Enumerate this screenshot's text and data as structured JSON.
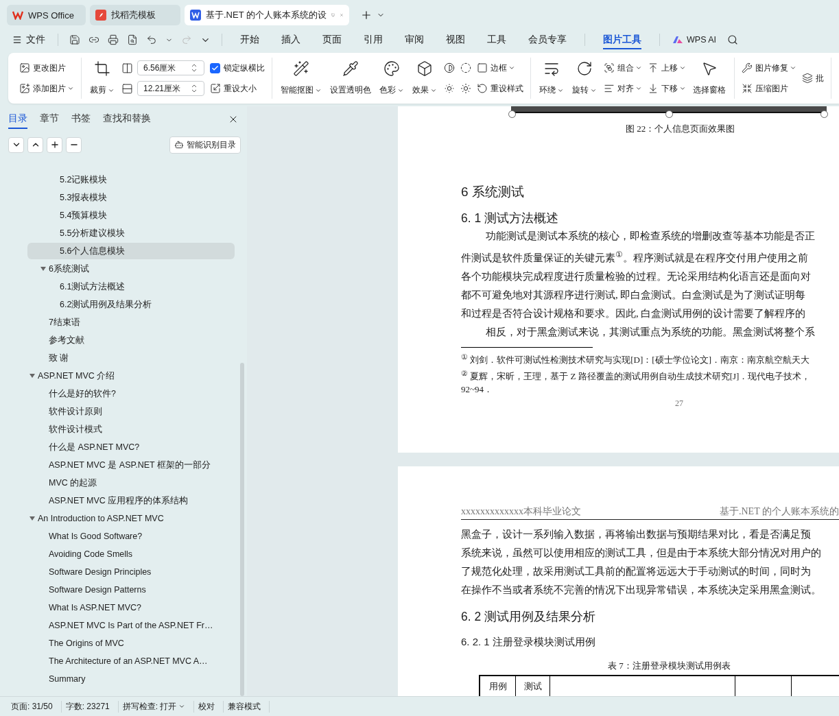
{
  "window_tabs": [
    {
      "kind": "home",
      "label": "WPS Office",
      "selected": false
    },
    {
      "kind": "template",
      "label": "找稻壳模板",
      "selected": false
    },
    {
      "kind": "document",
      "label": "基于.NET 的个人账本系统的设",
      "selected": true
    }
  ],
  "menu": {
    "file": "文件",
    "ai": "WPS AI",
    "tabs": [
      {
        "label": "开始",
        "selected": false,
        "contextual": false
      },
      {
        "label": "插入",
        "selected": false,
        "contextual": false
      },
      {
        "label": "页面",
        "selected": false,
        "contextual": false
      },
      {
        "label": "引用",
        "selected": false,
        "contextual": false
      },
      {
        "label": "审阅",
        "selected": false,
        "contextual": false
      },
      {
        "label": "视图",
        "selected": false,
        "contextual": false
      },
      {
        "label": "工具",
        "selected": false,
        "contextual": false
      },
      {
        "label": "会员专享",
        "selected": false,
        "contextual": false
      },
      {
        "label": "图片工具",
        "selected": true,
        "contextual": true
      }
    ]
  },
  "ribbon": {
    "groups": [
      [
        [
          {
            "kind": "small",
            "label": "更改图片",
            "dropdown": false
          },
          {
            "kind": "small",
            "label": "添加图片",
            "dropdown": true
          }
        ]
      ],
      [
        [
          {
            "kind": "big",
            "label": "裁剪",
            "dropdown": true
          }
        ],
        [
          {
            "kind": "field",
            "value": "6.56厘米"
          },
          {
            "kind": "field",
            "value": "12.21厘米"
          }
        ],
        [
          {
            "kind": "checkbox",
            "label": "锁定纵横比",
            "checked": true
          },
          {
            "kind": "small",
            "label": "重设大小",
            "dropdown": false
          }
        ]
      ],
      [
        [
          {
            "kind": "big",
            "label": "智能抠图",
            "dropdown": true
          }
        ],
        [
          {
            "kind": "big",
            "label": "设置透明色",
            "dropdown": false
          }
        ],
        [
          {
            "kind": "big",
            "label": "色彩",
            "dropdown": true
          }
        ],
        [
          {
            "kind": "big",
            "label": "效果",
            "dropdown": true
          }
        ],
        [
          {
            "kind": "icon"
          },
          {
            "kind": "icon"
          }
        ],
        [
          {
            "kind": "icon"
          },
          {
            "kind": "icon"
          }
        ],
        [
          {
            "kind": "small",
            "label": "边框",
            "dropdown": true
          },
          {
            "kind": "small",
            "label": "重设样式",
            "dropdown": false
          }
        ]
      ],
      [
        [
          {
            "kind": "big",
            "label": "环绕",
            "dropdown": true
          }
        ],
        [
          {
            "kind": "big",
            "label": "旋转",
            "dropdown": true
          }
        ],
        [
          {
            "kind": "small",
            "label": "组合",
            "dropdown": true
          },
          {
            "kind": "small",
            "label": "对齐",
            "dropdown": true
          }
        ],
        [
          {
            "kind": "small",
            "label": "上移",
            "dropdown": true
          },
          {
            "kind": "small",
            "label": "下移",
            "dropdown": true
          }
        ],
        [
          {
            "kind": "big",
            "label": "选择窗格",
            "dropdown": false
          }
        ]
      ],
      [
        [
          {
            "kind": "small",
            "label": "图片修复",
            "dropdown": true
          },
          {
            "kind": "small",
            "label": "压缩图片",
            "dropdown": false
          }
        ],
        [
          {
            "kind": "small",
            "label": "批",
            "dropdown": false
          }
        ]
      ]
    ]
  },
  "nav_pane": {
    "tabs": [
      {
        "label": "目录",
        "selected": true
      },
      {
        "label": "章节",
        "selected": false
      },
      {
        "label": "书签",
        "selected": false
      },
      {
        "label": "查找和替换",
        "selected": false
      }
    ],
    "smart_button": "智能识别目录",
    "toc": [
      {
        "children": [
          {
            "children": [
              {
                "label": "5.2记账模块",
                "selected": false
              },
              {
                "label": "5.3报表模块",
                "selected": false
              },
              {
                "label": "5.4预算模块",
                "selected": false
              },
              {
                "label": "5.5分析建议模块",
                "selected": false
              },
              {
                "label": "5.6个人信息模块",
                "selected": true
              }
            ]
          },
          {
            "label": "6系统测试",
            "selected": false,
            "expanded": true,
            "children": [
              {
                "label": "6.1测试方法概述",
                "selected": false
              },
              {
                "label": "6.2测试用例及结果分析",
                "selected": false
              }
            ]
          },
          {
            "label": "7结束语",
            "selected": false
          },
          {
            "label": "参考文献",
            "selected": false
          },
          {
            "label": "致 谢",
            "selected": false
          }
        ]
      },
      {
        "label": "ASP.NET MVC 介绍",
        "selected": false,
        "expanded": true,
        "children": [
          {
            "label": "什么是好的软件?",
            "selected": false
          },
          {
            "label": "软件设计原则",
            "selected": false
          },
          {
            "label": "软件设计模式",
            "selected": false
          },
          {
            "label": "什么是 ASP.NET MVC?",
            "selected": false
          },
          {
            "label": "ASP.NET MVC 是 ASP.NET 框架的一部分",
            "selected": false
          },
          {
            "label": "MVC 的起源",
            "selected": false
          },
          {
            "label": "ASP.NET MVC 应用程序的体系结构",
            "selected": false
          }
        ]
      },
      {
        "label": "An Introduction to ASP.NET MVC",
        "selected": false,
        "expanded": true,
        "children": [
          {
            "label": "What Is Good Software?",
            "selected": false
          },
          {
            "label": "Avoiding Code Smells",
            "selected": false
          },
          {
            "label": "Software Design Principles",
            "selected": false
          },
          {
            "label": "Software Design Patterns",
            "selected": false
          },
          {
            "label": "What Is ASP.NET MVC?",
            "selected": false
          },
          {
            "label": "ASP.NET MVC Is Part of the ASP.NET Fr…",
            "selected": false
          },
          {
            "label": "The Origins of MVC",
            "selected": false
          },
          {
            "label": "The Architecture of an ASP.NET MVC A…",
            "selected": false
          },
          {
            "label": "Summary",
            "selected": false
          }
        ]
      }
    ]
  },
  "document": {
    "pages": [
      {
        "image": {
          "selected": true
        },
        "blocks": [
          {
            "kind": "caption",
            "text": "图 22：个人信息页面效果图"
          },
          {
            "kind": "h1",
            "text": "6 系统测试"
          },
          {
            "kind": "h2",
            "text": "6. 1 测试方法概述"
          },
          {
            "kind": "first_line",
            "text": "功能测试是测试本系统的核心，即检查系统的增删改查等基本功能是否正"
          },
          {
            "kind": "line",
            "text": "件测试是软件质量保证的关键元素$^{①}$。程序测试就是在程序交付用户使用之前"
          },
          {
            "kind": "line",
            "text": "各个功能模块完成程度进行质量检验的过程。无论采用结构化语言还是面向对"
          },
          {
            "kind": "line",
            "text": "都不可避免地对其源程序进行测试, 即白盒测试。白盒测试是为了测试证明每"
          },
          {
            "kind": "line",
            "text": "和过程是否符合设计规格和要求。因此, 白盒测试用例的设计需要了解程序的"
          },
          {
            "kind": "first_line",
            "text": "相反，对于黑盒测试来说，其测试重点为系统的功能。黑盒测试将整个系"
          }
        ],
        "footnotes": [
          "$^{①}$ 刘剑．软件可测试性检测技术研究与实现[D]：[硕士学位论文]．南京：南京航空航天大",
          "$^{②}$ 夏辉，宋昕，王理，基于 Z 路径覆盖的测试用例自动生成技术研究[J]．现代电子技术，",
          "92~94．"
        ],
        "page_number": "27"
      },
      {
        "header_left": "xxxxxxxxxxxxx本科毕业论文",
        "header_right": "基于.NET 的个人账本系统的",
        "blocks": [
          {
            "kind": "line",
            "text": "黑盒子，设计一系列输入数据，再将输出数据与预期结果对比，看是否满足预"
          },
          {
            "kind": "line",
            "text": "系统来说，虽然可以使用相应的测试工具，但是由于本系统大部分情况对用户的"
          },
          {
            "kind": "line",
            "text": "了规范化处理，故采用测试工具前的配置将远远大于手动测试的时间，同时为"
          },
          {
            "kind": "line",
            "text": "在操作不当或者系统不完善的情况下出现异常错误，本系统决定采用黑盒测试。"
          },
          {
            "kind": "h2",
            "text": "6. 2 测试用例及结果分析"
          },
          {
            "kind": "h3",
            "text": "6. 2. 1 注册登录模块测试用例"
          },
          {
            "kind": "table_caption",
            "text": "表 7：注册登录模块测试用例表"
          }
        ],
        "table": {
          "columns": [
            "用例",
            "测试"
          ]
        }
      }
    ]
  },
  "status_bar": [
    {
      "label": "页面: 31/50",
      "dropdown": false
    },
    {
      "label": "字数: 23271",
      "dropdown": false
    },
    {
      "label": "拼写检查: 打开",
      "dropdown": true
    },
    {
      "label": "校对",
      "dropdown": false
    },
    {
      "label": "兼容模式",
      "dropdown": false
    }
  ]
}
